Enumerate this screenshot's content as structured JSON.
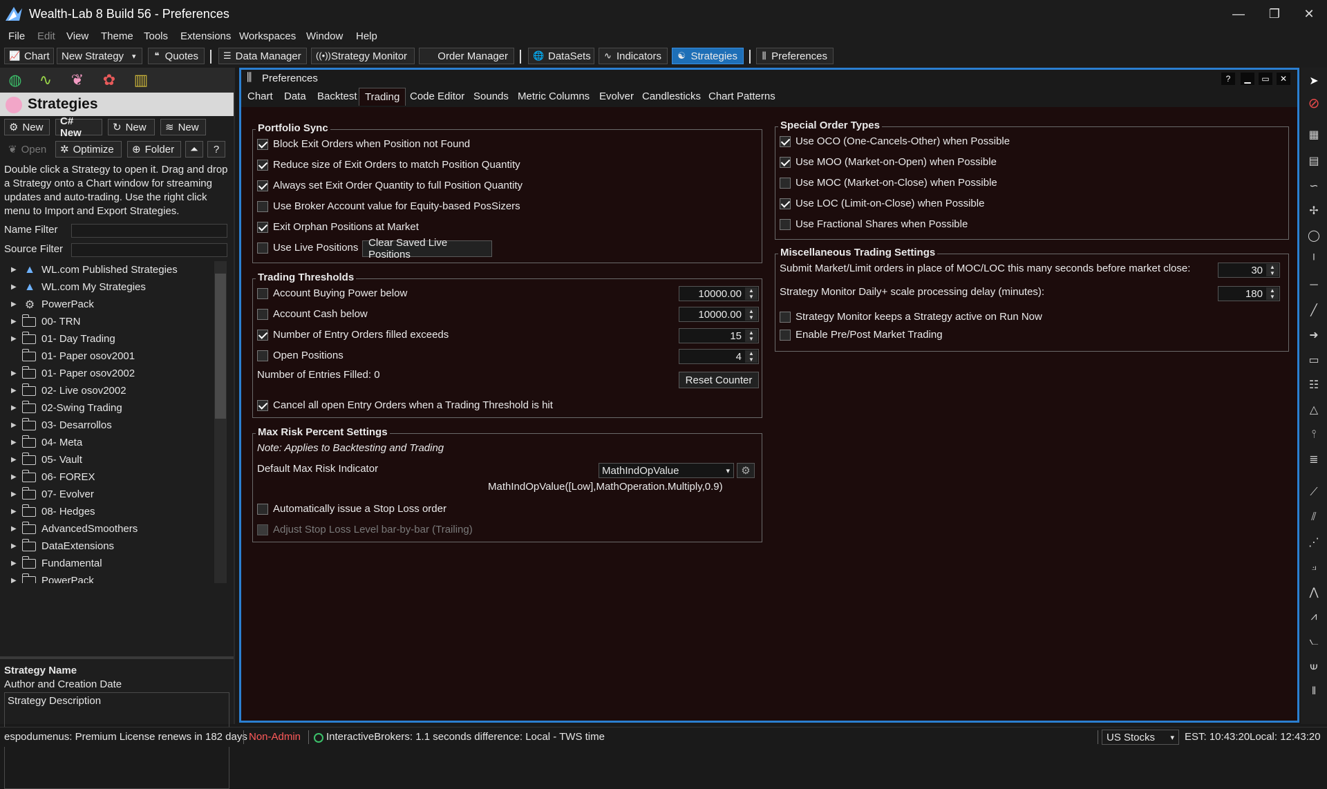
{
  "window": {
    "title": "Wealth-Lab 8 Build 56 - Preferences",
    "minimize_glyph": "—",
    "restore_glyph": "❐",
    "close_glyph": "✕"
  },
  "menu": [
    "File",
    "Edit",
    "View",
    "Theme",
    "Tools",
    "Extensions",
    "Workspaces",
    "Window",
    "Help"
  ],
  "toolbar": {
    "chart": "Chart",
    "new_strategy": "New Strategy",
    "quotes": "Quotes",
    "data_manager": "Data Manager",
    "strategy_monitor": "Strategy Monitor",
    "order_manager": "Order Manager",
    "datasets": "DataSets",
    "indicators": "Indicators",
    "strategies": "Strategies",
    "preferences": "Preferences"
  },
  "left": {
    "header": "Strategies",
    "btn_new1": "New",
    "btn_new2": "C# New",
    "btn_new3": "New",
    "btn_new4": "New",
    "btn_open": "Open",
    "btn_optimize": "Optimize",
    "btn_folder": "Folder",
    "btn_up": "⏶",
    "btn_help": "?",
    "help_text": "Double click a Strategy to open it. Drag and drop a Strategy onto a Chart window for streaming updates and auto-trading. Use the right click menu to Import and Export Strategies.",
    "name_filter_label": "Name Filter",
    "source_filter_label": "Source Filter",
    "tree": [
      "WL.com Published Strategies",
      "WL.com My Strategies",
      "PowerPack",
      "00- TRN",
      "01- Day Trading",
      "01- Paper osov2001",
      "01- Paper osov2002",
      "02- Live osov2002",
      "02-Swing Trading",
      "03- Desarrollos",
      "04- Meta",
      "05- Vault",
      "06- FOREX",
      "07- Evolver",
      "08- Hedges",
      "AdvancedSmoothers",
      "DataExtensions",
      "Fundamental",
      "PowerPack"
    ],
    "strategy_name": "Strategy Name",
    "author_date": "Author and Creation Date",
    "description": "Strategy Description"
  },
  "pref": {
    "title": "Preferences",
    "help": "?",
    "tabs": [
      "Chart",
      "Data",
      "Backtest",
      "Trading",
      "Code Editor",
      "Sounds",
      "Metric Columns",
      "Evolver",
      "Candlesticks",
      "Chart Patterns"
    ],
    "portfolio_sync": {
      "title": "Portfolio Sync",
      "items": [
        "Block Exit Orders when Position not Found",
        "Reduce size of Exit Orders to match Position Quantity",
        "Always set Exit Order Quantity to full Position Quantity",
        "Use Broker Account value for Equity-based PosSizers",
        "Exit Orphan Positions at Market",
        "Use Live Positions"
      ],
      "clear_button": "Clear Saved Live Positions"
    },
    "thresholds": {
      "title": "Trading Thresholds",
      "items": [
        "Account Buying Power below",
        "Account Cash below",
        "Number of Entry Orders filled exceeds",
        "Open Positions"
      ],
      "values": [
        "10000.00",
        "10000.00",
        "15",
        "4"
      ],
      "entries_filled": "Number of Entries Filled: 0",
      "reset_button": "Reset Counter",
      "cancel_all": "Cancel all open Entry Orders when a Trading Threshold is hit"
    },
    "max_risk": {
      "title": "Max Risk Percent Settings",
      "note": "Note: Applies to Backtesting and Trading",
      "default_label": "Default Max Risk Indicator",
      "indicator": "MathIndOpValue",
      "expression": "MathIndOpValue([Low],MathOperation.Multiply,0.9)",
      "auto_stop": "Automatically issue a Stop Loss order",
      "trailing": "Adjust Stop Loss Level bar-by-bar (Trailing)"
    },
    "special": {
      "title": "Special Order Types",
      "items": [
        "Use OCO (One-Cancels-Other) when Possible",
        "Use MOO (Market-on-Open) when Possible",
        "Use MOC (Market-on-Close) when Possible",
        "Use LOC (Limit-on-Close) when Possible",
        "Use Fractional Shares when Possible"
      ]
    },
    "misc": {
      "title": "Miscellaneous Trading Settings",
      "submit_label": "Submit Market/Limit orders in place of MOC/LOC this many seconds before market close:",
      "submit_value": "30",
      "delay_label": "Strategy Monitor Daily+ scale processing delay (minutes):",
      "delay_value": "180",
      "keep_active": "Strategy Monitor keeps a Strategy active on Run Now",
      "prepost": "Enable Pre/Post Market Trading"
    }
  },
  "status": {
    "license": "espodumenus: Premium License renews in 182 days",
    "role": "Non-Admin",
    "role_color": "#ff5a5a",
    "broker": "InteractiveBrokers: 1.1 seconds difference: Local - TWS time",
    "market": "US Stocks",
    "est": "EST: 10:43:20",
    "local": "Local: 12:43:20"
  }
}
